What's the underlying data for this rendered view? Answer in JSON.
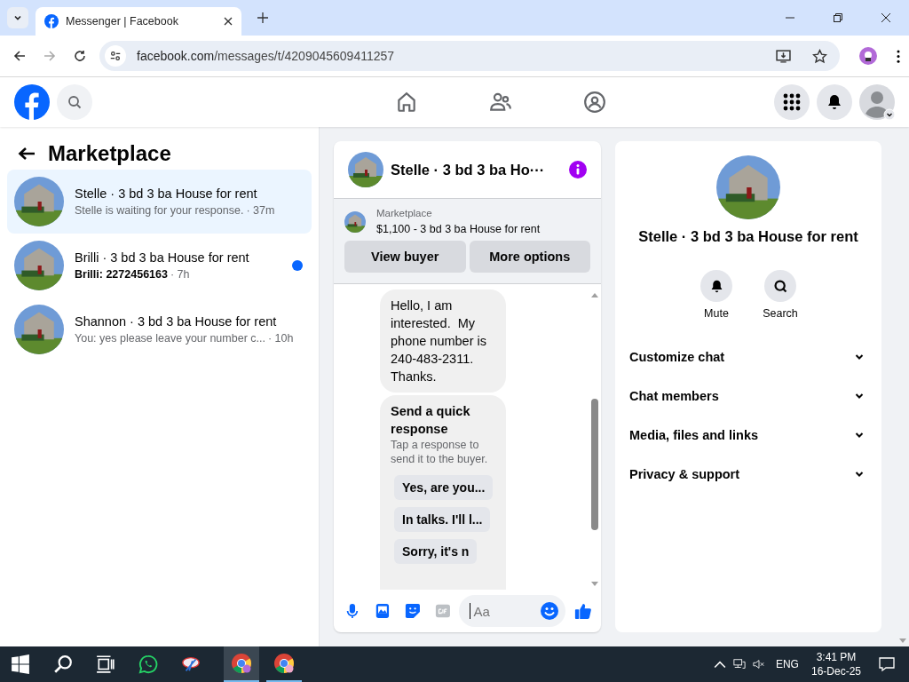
{
  "browser": {
    "tab_title": "Messenger | Facebook",
    "url_domain": "facebook.com",
    "url_path": "/messages/t/4209045609411257"
  },
  "sidebar": {
    "title": "Marketplace",
    "conversations": [
      {
        "name": "Stelle · 3 bd 3 ba House for rent",
        "preview": "Stelle is waiting for your response.",
        "time": "· 37m",
        "unread": false,
        "selected": true
      },
      {
        "name": "Brilli · 3 bd 3 ba House for rent",
        "preview": "Brilli: 2272456163",
        "time": "· 7h",
        "unread": true,
        "selected": false
      },
      {
        "name": "Shannon · 3 bd 3 ba House for rent",
        "preview": "You: yes please leave your number c...",
        "time": "· 10h",
        "unread": false,
        "selected": false
      }
    ]
  },
  "chat": {
    "title": "Stelle · 3 bd 3 ba Ho···",
    "listing": {
      "label": "Marketplace",
      "title": "$1,100 - 3 bd 3 ba House for rent"
    },
    "buttons": [
      "View buyer",
      "More options"
    ],
    "message": "Hello, I am interested.  My phone number is 240-483-2311. Thanks.",
    "quick_response": {
      "title": "Send a quick response",
      "hint": "Tap a response to send it to the buyer.",
      "options": [
        "Yes, are you...",
        "In talks. I'll l...",
        "Sorry, it's n"
      ]
    },
    "composer": {
      "placeholder": "Aa"
    }
  },
  "info": {
    "title": "Stelle · 3 bd 3 ba House for rent",
    "actions": [
      {
        "kind": "mute",
        "label": "Mute"
      },
      {
        "kind": "search",
        "label": "Search"
      }
    ],
    "sections": [
      "Customize chat",
      "Chat members",
      "Media, files and links",
      "Privacy & support"
    ]
  },
  "taskbar": {
    "language": "ENG",
    "time": "3:41 PM",
    "date": "16-Dec-25"
  }
}
